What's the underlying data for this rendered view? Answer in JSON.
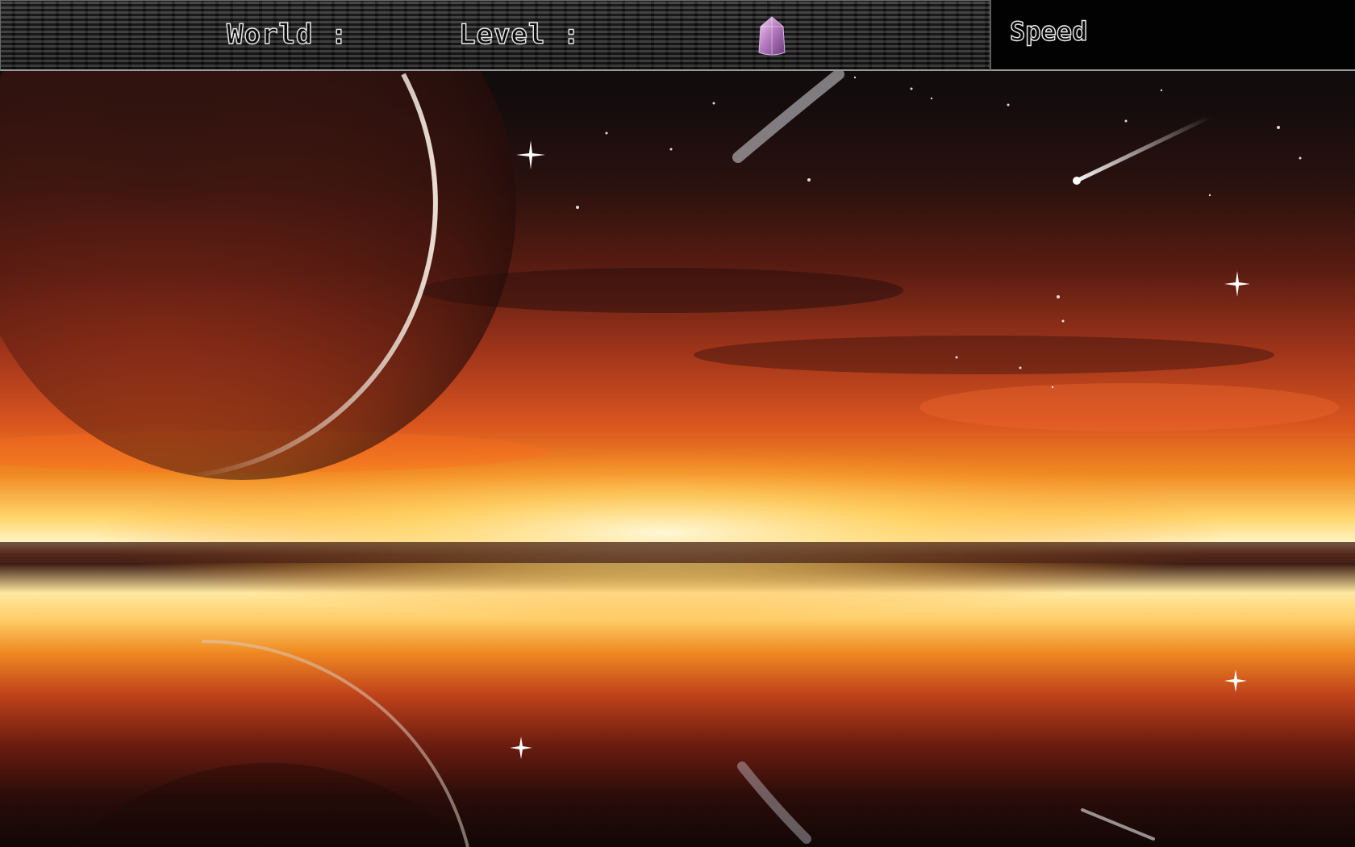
{
  "hud": {
    "world_label": "World :",
    "level_label": "Level :",
    "speed_label": "Speed",
    "gem_icon": "purple-crystal-icon"
  },
  "scene": {
    "background": "sunset-horizon-with-planet-and-reflection",
    "colors": {
      "sky_top": "#0b0a0c",
      "cloud_orange": "#d8541e",
      "horizon_glow": "#fff3c2",
      "hud_panel": "#2e2e2e",
      "speed_panel": "#020202"
    }
  }
}
